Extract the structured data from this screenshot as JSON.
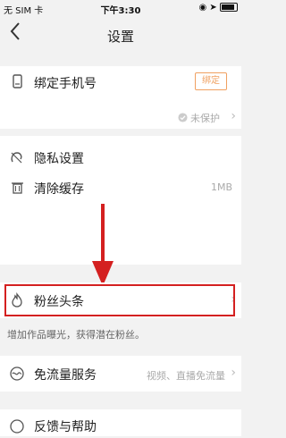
{
  "status": {
    "carrier": "无 SIM 卡",
    "time": "下午3:30"
  },
  "nav": {
    "title": "设置"
  },
  "settings": {
    "bind_phone": {
      "label": "绑定手机号",
      "button": "绑定",
      "status": "未保护"
    },
    "privacy": {
      "label": "隐私设置"
    },
    "cache": {
      "label": "清除缓存",
      "size": "1MB"
    },
    "fans": {
      "label": "粉丝头条",
      "hint": "增加作品曝光，获得潜在粉丝。"
    },
    "traffic": {
      "label": "免流量服务",
      "desc": "视频、直播免流量"
    },
    "feedback": {
      "label": "反馈与帮助"
    }
  },
  "colors": {
    "accent": "#f0a060",
    "highlight": "#d42020",
    "arrow": "#d42020"
  },
  "icons": {
    "back": "chevron-left-icon",
    "phone": "phone-icon",
    "privacy": "privacy-icon",
    "cache": "trash-icon",
    "fans": "flame-icon",
    "traffic": "wave-icon",
    "feedback": "help-icon",
    "shield": "shield-check-icon"
  }
}
